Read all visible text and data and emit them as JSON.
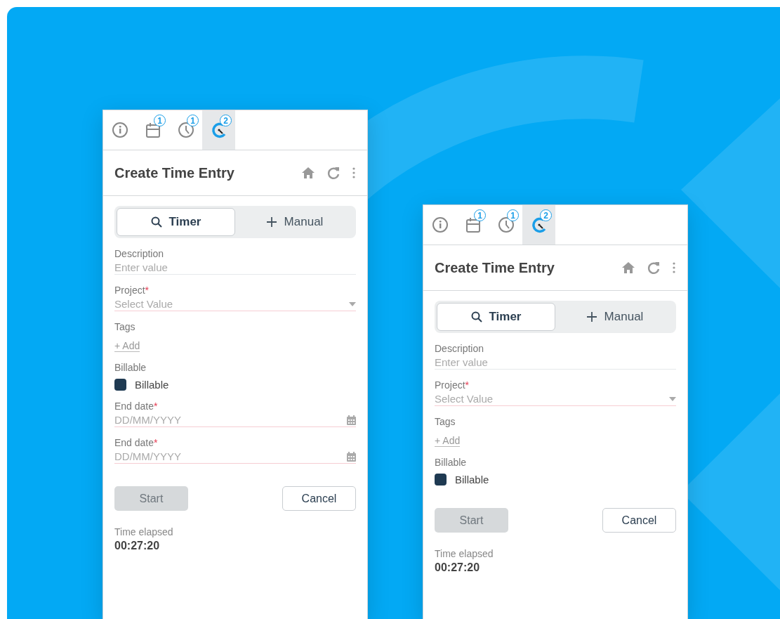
{
  "panels": [
    {
      "tabs": [
        {
          "kind": "info",
          "selected": false
        },
        {
          "kind": "calendar",
          "badge": "1",
          "selected": false
        },
        {
          "kind": "clock",
          "badge": "1",
          "selected": false
        },
        {
          "kind": "timer",
          "badge": "2",
          "selected": true
        }
      ],
      "title": "Create Time Entry",
      "modes": [
        {
          "kind": "search",
          "label": "Timer",
          "selected": true
        },
        {
          "kind": "plus",
          "label": "Manual",
          "selected": false
        }
      ],
      "fields": [
        {
          "kind": "text",
          "label": "Description",
          "placeholder": "Enter value"
        },
        {
          "kind": "select",
          "label": "Project",
          "required_mark": "*",
          "placeholder": "Select Value"
        },
        {
          "kind": "tags",
          "label": "Tags",
          "action": "+ Add"
        },
        {
          "kind": "checkbox",
          "label": "Billable",
          "option": "Billable",
          "checked": true
        },
        {
          "kind": "date",
          "label": "End date",
          "required_mark": "*",
          "placeholder": "DD/MM/YYYY"
        },
        {
          "kind": "date",
          "label": "End date",
          "required_mark": "*",
          "placeholder": "DD/MM/YYYY"
        }
      ],
      "buttons": [
        {
          "label": "Start",
          "kind": "primary",
          "disabled": true
        },
        {
          "label": "Cancel",
          "kind": "secondary",
          "disabled": false
        }
      ],
      "elapsed": {
        "label": "Time elapsed",
        "value": "00:27:20"
      }
    },
    {
      "tabs": [
        {
          "kind": "info",
          "selected": false
        },
        {
          "kind": "calendar",
          "badge": "1",
          "selected": false
        },
        {
          "kind": "clock",
          "badge": "1",
          "selected": false
        },
        {
          "kind": "timer",
          "badge": "2",
          "selected": true
        }
      ],
      "title": "Create Time Entry",
      "modes": [
        {
          "kind": "search",
          "label": "Timer",
          "selected": true
        },
        {
          "kind": "plus",
          "label": "Manual",
          "selected": false
        }
      ],
      "fields": [
        {
          "kind": "text",
          "label": "Description",
          "placeholder": "Enter value"
        },
        {
          "kind": "select",
          "label": "Project",
          "required_mark": "*",
          "placeholder": "Select Value"
        },
        {
          "kind": "tags",
          "label": "Tags",
          "action": "+ Add"
        },
        {
          "kind": "checkbox",
          "label": "Billable",
          "option": "Billable",
          "checked": true
        }
      ],
      "buttons": [
        {
          "label": "Start",
          "kind": "primary",
          "disabled": true
        },
        {
          "label": "Cancel",
          "kind": "secondary",
          "disabled": false
        }
      ],
      "elapsed": {
        "label": "Time elapsed",
        "value": "00:27:20"
      }
    }
  ]
}
